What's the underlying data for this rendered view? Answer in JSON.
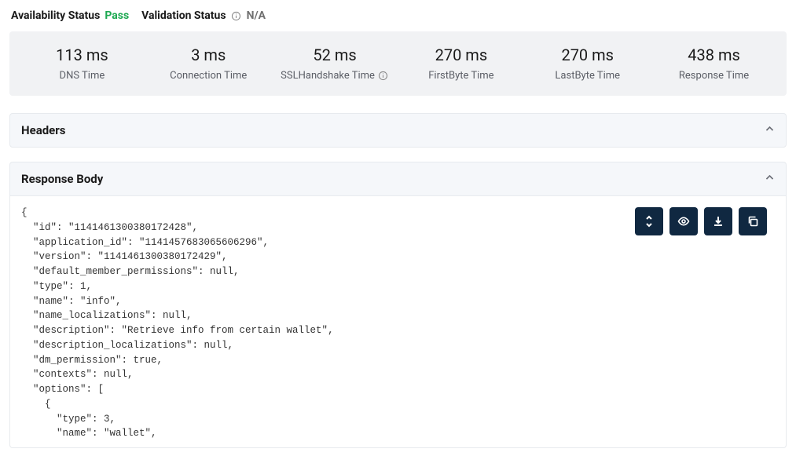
{
  "status": {
    "availability_label": "Availability Status",
    "availability_value": "Pass",
    "validation_label": "Validation Status",
    "validation_value": "N/A"
  },
  "metrics": {
    "dns": {
      "value": "113 ms",
      "label": "DNS Time"
    },
    "connection": {
      "value": "3 ms",
      "label": "Connection Time"
    },
    "ssl": {
      "value": "52 ms",
      "label": "SSLHandshake Time"
    },
    "firstbyte": {
      "value": "270 ms",
      "label": "FirstByte Time"
    },
    "lastbyte": {
      "value": "270 ms",
      "label": "LastByte Time"
    },
    "response": {
      "value": "438 ms",
      "label": "Response Time"
    }
  },
  "sections": {
    "headers_title": "Headers",
    "response_body_title": "Response Body"
  },
  "response_body": "{\n  \"id\": \"1141461300380172428\",\n  \"application_id\": \"1141457683065606296\",\n  \"version\": \"1141461300380172429\",\n  \"default_member_permissions\": null,\n  \"type\": 1,\n  \"name\": \"info\",\n  \"name_localizations\": null,\n  \"description\": \"Retrieve info from certain wallet\",\n  \"description_localizations\": null,\n  \"dm_permission\": true,\n  \"contexts\": null,\n  \"options\": [\n    {\n      \"type\": 3,\n      \"name\": \"wallet\","
}
